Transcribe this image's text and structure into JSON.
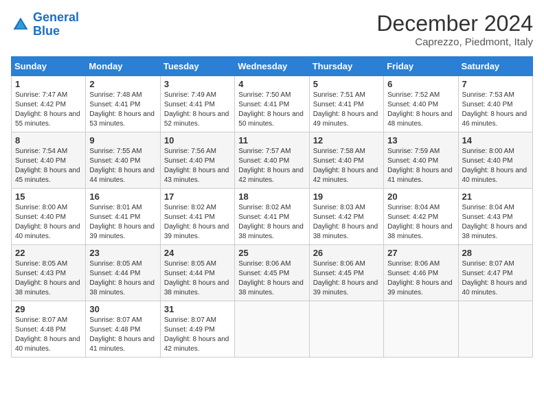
{
  "header": {
    "logo_general": "General",
    "logo_blue": "Blue",
    "title": "December 2024",
    "subtitle": "Caprezzo, Piedmont, Italy"
  },
  "columns": [
    "Sunday",
    "Monday",
    "Tuesday",
    "Wednesday",
    "Thursday",
    "Friday",
    "Saturday"
  ],
  "weeks": [
    [
      {
        "day": "1",
        "sunrise": "Sunrise: 7:47 AM",
        "sunset": "Sunset: 4:42 PM",
        "daylight": "Daylight: 8 hours and 55 minutes."
      },
      {
        "day": "2",
        "sunrise": "Sunrise: 7:48 AM",
        "sunset": "Sunset: 4:41 PM",
        "daylight": "Daylight: 8 hours and 53 minutes."
      },
      {
        "day": "3",
        "sunrise": "Sunrise: 7:49 AM",
        "sunset": "Sunset: 4:41 PM",
        "daylight": "Daylight: 8 hours and 52 minutes."
      },
      {
        "day": "4",
        "sunrise": "Sunrise: 7:50 AM",
        "sunset": "Sunset: 4:41 PM",
        "daylight": "Daylight: 8 hours and 50 minutes."
      },
      {
        "day": "5",
        "sunrise": "Sunrise: 7:51 AM",
        "sunset": "Sunset: 4:41 PM",
        "daylight": "Daylight: 8 hours and 49 minutes."
      },
      {
        "day": "6",
        "sunrise": "Sunrise: 7:52 AM",
        "sunset": "Sunset: 4:40 PM",
        "daylight": "Daylight: 8 hours and 48 minutes."
      },
      {
        "day": "7",
        "sunrise": "Sunrise: 7:53 AM",
        "sunset": "Sunset: 4:40 PM",
        "daylight": "Daylight: 8 hours and 46 minutes."
      }
    ],
    [
      {
        "day": "8",
        "sunrise": "Sunrise: 7:54 AM",
        "sunset": "Sunset: 4:40 PM",
        "daylight": "Daylight: 8 hours and 45 minutes."
      },
      {
        "day": "9",
        "sunrise": "Sunrise: 7:55 AM",
        "sunset": "Sunset: 4:40 PM",
        "daylight": "Daylight: 8 hours and 44 minutes."
      },
      {
        "day": "10",
        "sunrise": "Sunrise: 7:56 AM",
        "sunset": "Sunset: 4:40 PM",
        "daylight": "Daylight: 8 hours and 43 minutes."
      },
      {
        "day": "11",
        "sunrise": "Sunrise: 7:57 AM",
        "sunset": "Sunset: 4:40 PM",
        "daylight": "Daylight: 8 hours and 42 minutes."
      },
      {
        "day": "12",
        "sunrise": "Sunrise: 7:58 AM",
        "sunset": "Sunset: 4:40 PM",
        "daylight": "Daylight: 8 hours and 42 minutes."
      },
      {
        "day": "13",
        "sunrise": "Sunrise: 7:59 AM",
        "sunset": "Sunset: 4:40 PM",
        "daylight": "Daylight: 8 hours and 41 minutes."
      },
      {
        "day": "14",
        "sunrise": "Sunrise: 8:00 AM",
        "sunset": "Sunset: 4:40 PM",
        "daylight": "Daylight: 8 hours and 40 minutes."
      }
    ],
    [
      {
        "day": "15",
        "sunrise": "Sunrise: 8:00 AM",
        "sunset": "Sunset: 4:40 PM",
        "daylight": "Daylight: 8 hours and 40 minutes."
      },
      {
        "day": "16",
        "sunrise": "Sunrise: 8:01 AM",
        "sunset": "Sunset: 4:41 PM",
        "daylight": "Daylight: 8 hours and 39 minutes."
      },
      {
        "day": "17",
        "sunrise": "Sunrise: 8:02 AM",
        "sunset": "Sunset: 4:41 PM",
        "daylight": "Daylight: 8 hours and 39 minutes."
      },
      {
        "day": "18",
        "sunrise": "Sunrise: 8:02 AM",
        "sunset": "Sunset: 4:41 PM",
        "daylight": "Daylight: 8 hours and 38 minutes."
      },
      {
        "day": "19",
        "sunrise": "Sunrise: 8:03 AM",
        "sunset": "Sunset: 4:42 PM",
        "daylight": "Daylight: 8 hours and 38 minutes."
      },
      {
        "day": "20",
        "sunrise": "Sunrise: 8:04 AM",
        "sunset": "Sunset: 4:42 PM",
        "daylight": "Daylight: 8 hours and 38 minutes."
      },
      {
        "day": "21",
        "sunrise": "Sunrise: 8:04 AM",
        "sunset": "Sunset: 4:43 PM",
        "daylight": "Daylight: 8 hours and 38 minutes."
      }
    ],
    [
      {
        "day": "22",
        "sunrise": "Sunrise: 8:05 AM",
        "sunset": "Sunset: 4:43 PM",
        "daylight": "Daylight: 8 hours and 38 minutes."
      },
      {
        "day": "23",
        "sunrise": "Sunrise: 8:05 AM",
        "sunset": "Sunset: 4:44 PM",
        "daylight": "Daylight: 8 hours and 38 minutes."
      },
      {
        "day": "24",
        "sunrise": "Sunrise: 8:05 AM",
        "sunset": "Sunset: 4:44 PM",
        "daylight": "Daylight: 8 hours and 38 minutes."
      },
      {
        "day": "25",
        "sunrise": "Sunrise: 8:06 AM",
        "sunset": "Sunset: 4:45 PM",
        "daylight": "Daylight: 8 hours and 38 minutes."
      },
      {
        "day": "26",
        "sunrise": "Sunrise: 8:06 AM",
        "sunset": "Sunset: 4:45 PM",
        "daylight": "Daylight: 8 hours and 39 minutes."
      },
      {
        "day": "27",
        "sunrise": "Sunrise: 8:06 AM",
        "sunset": "Sunset: 4:46 PM",
        "daylight": "Daylight: 8 hours and 39 minutes."
      },
      {
        "day": "28",
        "sunrise": "Sunrise: 8:07 AM",
        "sunset": "Sunset: 4:47 PM",
        "daylight": "Daylight: 8 hours and 40 minutes."
      }
    ],
    [
      {
        "day": "29",
        "sunrise": "Sunrise: 8:07 AM",
        "sunset": "Sunset: 4:48 PM",
        "daylight": "Daylight: 8 hours and 40 minutes."
      },
      {
        "day": "30",
        "sunrise": "Sunrise: 8:07 AM",
        "sunset": "Sunset: 4:48 PM",
        "daylight": "Daylight: 8 hours and 41 minutes."
      },
      {
        "day": "31",
        "sunrise": "Sunrise: 8:07 AM",
        "sunset": "Sunset: 4:49 PM",
        "daylight": "Daylight: 8 hours and 42 minutes."
      },
      null,
      null,
      null,
      null
    ]
  ]
}
